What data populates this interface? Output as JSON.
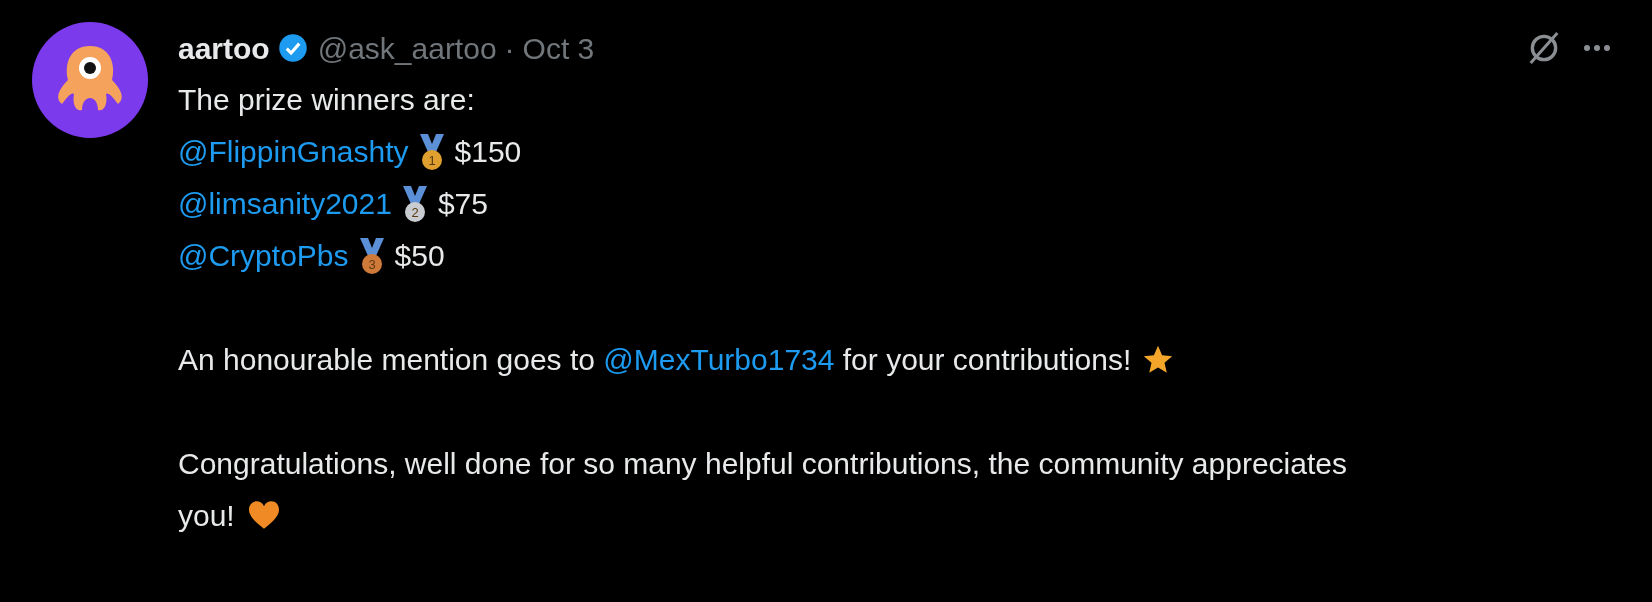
{
  "post": {
    "author": {
      "name": "aartoo",
      "verified": true,
      "handle": "@ask_aartoo",
      "separator": "·",
      "date": "Oct 3"
    },
    "intro": "The prize winners are:",
    "winners": [
      {
        "handle": "@FlippinGnashty",
        "medal": "1",
        "color": "#e0a030",
        "prize": "$150"
      },
      {
        "handle": "@limsanity2021",
        "medal": "2",
        "color": "#c8ccd0",
        "prize": "$75"
      },
      {
        "handle": "@CryptoPbs",
        "medal": "3",
        "color": "#d07a3a",
        "prize": "$50"
      }
    ],
    "mention": {
      "before": "An honourable mention goes to",
      "handle": "@MexTurbo1734",
      "after": "for your contributions!"
    },
    "closing": "Congratulations, well done for so many helpful contributions, the community appreciates you!"
  }
}
